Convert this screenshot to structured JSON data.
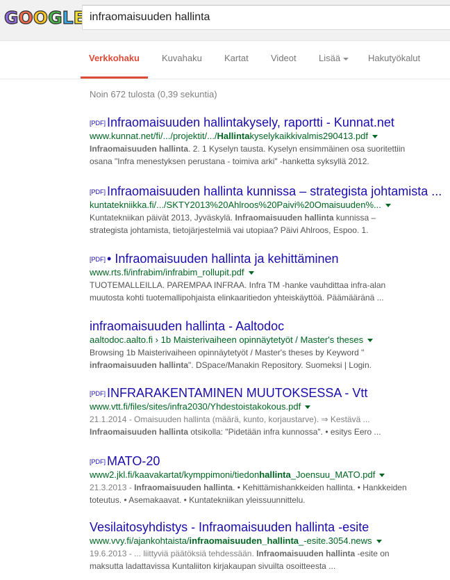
{
  "search": {
    "query": "infraomaisuuden hallinta"
  },
  "logo": {
    "letters": [
      {
        "ch": "G",
        "color": "#8c6bd6"
      },
      {
        "ch": "O",
        "color": "#f06b4e"
      },
      {
        "ch": "O",
        "color": "#f7c325"
      },
      {
        "ch": "G",
        "color": "#4db44d"
      },
      {
        "ch": "L",
        "color": "#3ea6e0"
      },
      {
        "ch": "E",
        "color": "#f3df3a"
      }
    ]
  },
  "tabs": {
    "web": "Verkkohaku",
    "images": "Kuvahaku",
    "maps": "Kartat",
    "videos": "Videot",
    "more": "Lisää",
    "tools": "Hakutyökalut"
  },
  "stats": "Noin 672 tulosta (0,39 sekuntia)",
  "results": [
    {
      "pdf": "[PDF]",
      "title": "Infraomaisuuden hallintakysely, raportti - Kunnat.net",
      "url": [
        "www.kunnat.net/fi/.../projektit/.../",
        "Hallinta",
        "kyselykaikkivalmis290413.pdf"
      ],
      "snippet": [
        [
          "Infraomaisuuden hallinta",
          ". 2. 1 Kyselyn tausta. Kyselyn ensimmäinen osa suoritettiin"
        ],
        [
          "",
          "osana \"Infra menestyksen perustana - toimiva arki\" -hanketta syksyllä 2012."
        ]
      ]
    },
    {
      "pdf": "[PDF]",
      "title": "Infraomaisuuden hallinta kunnissa – strategista johtamista ...",
      "url": [
        "kuntatekniikka.fi/.../SKTY2013%20Ahlroos%20Paivi%20Omaisuuden%...",
        "",
        ""
      ],
      "snippet": [
        [
          "",
          "Kuntatekniikan päivät 2013, Jyväskylä. ",
          "Infraomaisuuden hallinta",
          " kunnissa –"
        ],
        [
          "",
          "strategista johtamista, tietojärjestelmiä vai utopiaa? Päivi Ahlroos, Espoo. 1."
        ]
      ]
    },
    {
      "pdf": "[PDF]",
      "title": "• Infraomaisuuden hallinta ja kehittäminen",
      "url": [
        "www.rts.fi/infrabim/infrabim_rollupit.pdf",
        "",
        ""
      ],
      "snippet": [
        [
          "",
          "TUOTEMALLEILLA. PAREMPAA INFRAA. Infra TM -hanke vauhdittaa infra-alan"
        ],
        [
          "",
          "muutosta kohti tuotemallipohjaista elinkaaritiedon yhteiskäyttöä. Päämääränä ..."
        ]
      ]
    },
    {
      "pdf": "",
      "title": "infraomaisuuden hallinta - Aaltodoc",
      "url": [
        "aaltodoc.aalto.fi › 1b Maisterivaiheen opinnäytetyöt / Master's theses",
        "",
        ""
      ],
      "snippet": [
        [
          "",
          "Browsing 1b Maisterivaiheen opinnäytetyöt / Master's theses by Keyword \""
        ],
        [
          "infraomaisuuden hallinta",
          "\". DSpace/Manakin Repository. Suomeksi | Login."
        ]
      ]
    },
    {
      "pdf": "[PDF]",
      "title": "INFRARAKENTAMINEN MUUTOKSESSA - Vtt",
      "url": [
        "www.vtt.fi/files/sites/infra2030/Yhdestoistakokous.pdf",
        "",
        ""
      ],
      "snippet": [
        [
          "",
          "21.1.2014 - Omaisuuden hallinta (määrä, kunto, korjaustarve). ⇒ Kestävä ..."
        ],
        [
          "Infraomaisuuden hallinta",
          " otsikolla: \"Pidetään infra kunnossa\". • esitys Eero ..."
        ]
      ]
    },
    {
      "pdf": "[PDF]",
      "title": "MATO-20",
      "url": [
        "www2.jkl.fi/kaavakartat/kymppimoni/tiedon",
        "hallinta",
        "_Joensuu_MATO.pdf"
      ],
      "snippet": [
        [
          "",
          "21.3.2013 - ",
          "Infraomaisuuden hallinta",
          ". • Kehittämishankkeiden hallinta. • Hankkeiden"
        ],
        [
          "",
          "toteutus. • Asemakaavat. • Kuntatekniikan yleissuunnittelu."
        ]
      ]
    },
    {
      "pdf": "",
      "title": "Vesilaitosyhdistys - Infraomaisuuden hallinta -esite",
      "url": [
        "www.vvy.fi/ajankohtaista/",
        "infraomaisuuden_hallinta",
        "_-esite.3054.news"
      ],
      "snippet": [
        [
          "",
          "19.6.2013 - ... liittyviä päätöksiä tehdessään. ",
          "Infraomaisuuden hallinta",
          " -esite on"
        ],
        [
          "",
          "maksutta ladattavissa Kuntaliiton kirjakaupan sivuilta osoitteesta ..."
        ]
      ]
    }
  ]
}
